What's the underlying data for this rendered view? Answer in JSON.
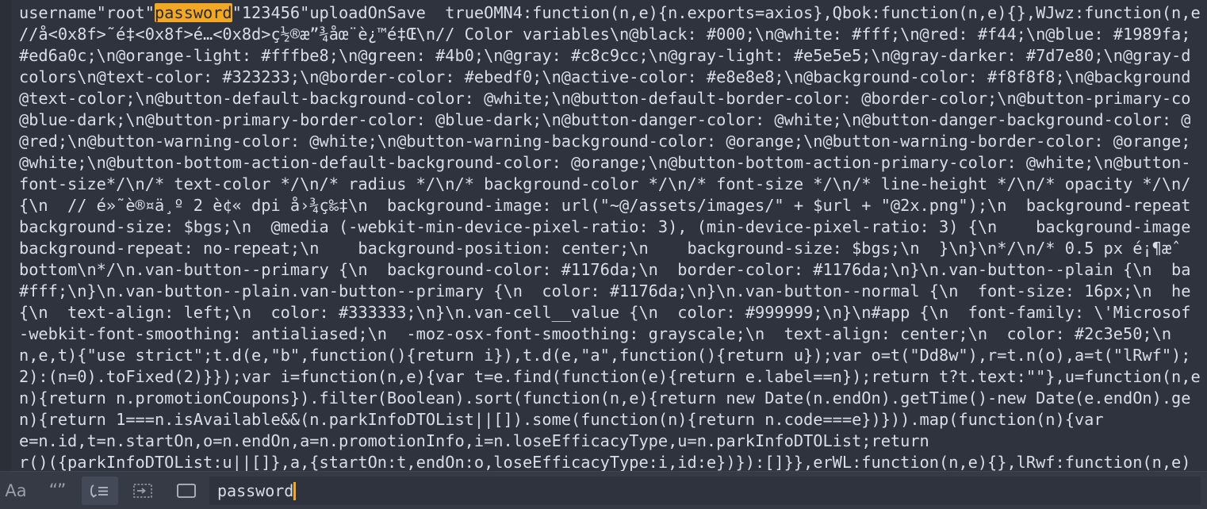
{
  "editor": {
    "lines": [
      {
        "pre": "username\"root\"",
        "match": "password",
        "post": "\"123456\"uploadOnSave  trueOMN4:function(n,e){n.exports=axios},Qbok:function(n,e){},WJwz:function(n,e"
      },
      {
        "text": "//å<0x8f>˜é‡<0x8f>é…<0x8d>ç½®æ”¾åœ¨è¿™é‡Œ\\n// Color variables\\n@black: #000;\\n@white: #fff;\\n@red: #f44;\\n@blue: #1989fa;"
      },
      {
        "text": "#ed6a0c;\\n@orange-light: #fffbe8;\\n@green: #4b0;\\n@gray: #c8c9cc;\\n@gray-light: #e5e5e5;\\n@gray-darker: #7d7e80;\\n@gray-d"
      },
      {
        "text": "colors\\n@text-color: #323233;\\n@border-color: #ebedf0;\\n@active-color: #e8e8e8;\\n@background-color: #f8f8f8;\\n@background"
      },
      {
        "text": "@text-color;\\n@button-default-background-color: @white;\\n@button-default-border-color: @border-color;\\n@button-primary-co"
      },
      {
        "text": "@blue-dark;\\n@button-primary-border-color: @blue-dark;\\n@button-danger-color: @white;\\n@button-danger-background-color: @"
      },
      {
        "text": "@red;\\n@button-warning-color: @white;\\n@button-warning-background-color: @orange;\\n@button-warning-border-color: @orange;"
      },
      {
        "text": "@white;\\n@button-bottom-action-default-background-color: @orange;\\n@button-bottom-action-primary-color: @white;\\n@button-"
      },
      {
        "text": "font-size*/\\n/* text-color */\\n/* radius */\\n/* background-color */\\n/* font-size */\\n/* line-height */\\n/* opacity */\\n/"
      },
      {
        "text": "{\\n  // é»˜è®¤ä¸º 2 è¢« dpi å›¾ç‰‡\\n  background-image: url(\"~@/assets/images/\" + $url + \"@2x.png\");\\n  background-repeat"
      },
      {
        "text": "background-size: $bgs;\\n  @media (-webkit-min-device-pixel-ratio: 3), (min-device-pixel-ratio: 3) {\\n    background-image"
      },
      {
        "text": "background-repeat: no-repeat;\\n    background-position: center;\\n    background-size: $bgs;\\n  }\\n}\\n*/\\n/* 0.5 px é¡¶æˆ"
      },
      {
        "text": "bottom\\n*/\\n.van-button--primary {\\n  background-color: #1176da;\\n  border-color: #1176da;\\n}\\n.van-button--plain {\\n  ba"
      },
      {
        "text": "#fff;\\n}\\n.van-button--plain.van-button--primary {\\n  color: #1176da;\\n}\\n.van-button--normal {\\n  font-size: 16px;\\n  he"
      },
      {
        "text": "{\\n  text-align: left;\\n  color: #333333;\\n}\\n.van-cell__value {\\n  color: #999999;\\n}\\n#app {\\n  font-family: \\'Microsof"
      },
      {
        "text": "-webkit-font-smoothing: antialiased;\\n  -moz-osx-font-smoothing: grayscale;\\n  text-align: center;\\n  color: #2c3e50;\\n  "
      },
      {
        "text": "n,e,t){\"use strict\";t.d(e,\"b\",function(){return i}),t.d(e,\"a\",function(){return u});var o=t(\"Dd8w\"),r=t.n(o),a=t(\"lRwf\");"
      },
      {
        "text": "2):(n=0).toFixed(2)}});var i=function(n,e){var t=e.find(function(e){return e.label==n});return t?t.text:\"\"},u=function(n,e"
      },
      {
        "text": "n){return n.promotionCoupons}).filter(Boolean).sort(function(n,e){return new Date(n.endOn).getTime()-new Date(e.endOn).ge"
      },
      {
        "text": "n){return 1===n.isAvailable&&(n.parkInfoDTOList||[]).some(function(n){return n.code===e})})).map(function(n){var"
      },
      {
        "text": "e=n.id,t=n.startOn,o=n.endOn,a=n.promotionInfo,i=n.loseEfficacyType,u=n.parkInfoDTOList;return"
      },
      {
        "text": "r()({parkInfoDTOList:u||[]},a,{startOn:t,endOn:o,loseEfficacyType:i,id:e})}):[]}},erWL:function(n,e){},lRwf:function(n,e)"
      }
    ]
  },
  "findbar": {
    "case_label": "Aa",
    "word_label": "“”",
    "query": "password",
    "icons": {
      "case": "case-sensitive-icon",
      "word": "whole-word-icon",
      "wrap": "wrap-icon",
      "selection": "in-selection-icon",
      "highlight": "highlight-matches-icon"
    }
  },
  "colors": {
    "match_highlight": "#f2a824",
    "editor_background": "#2f333d",
    "text": "#d8dee9"
  }
}
